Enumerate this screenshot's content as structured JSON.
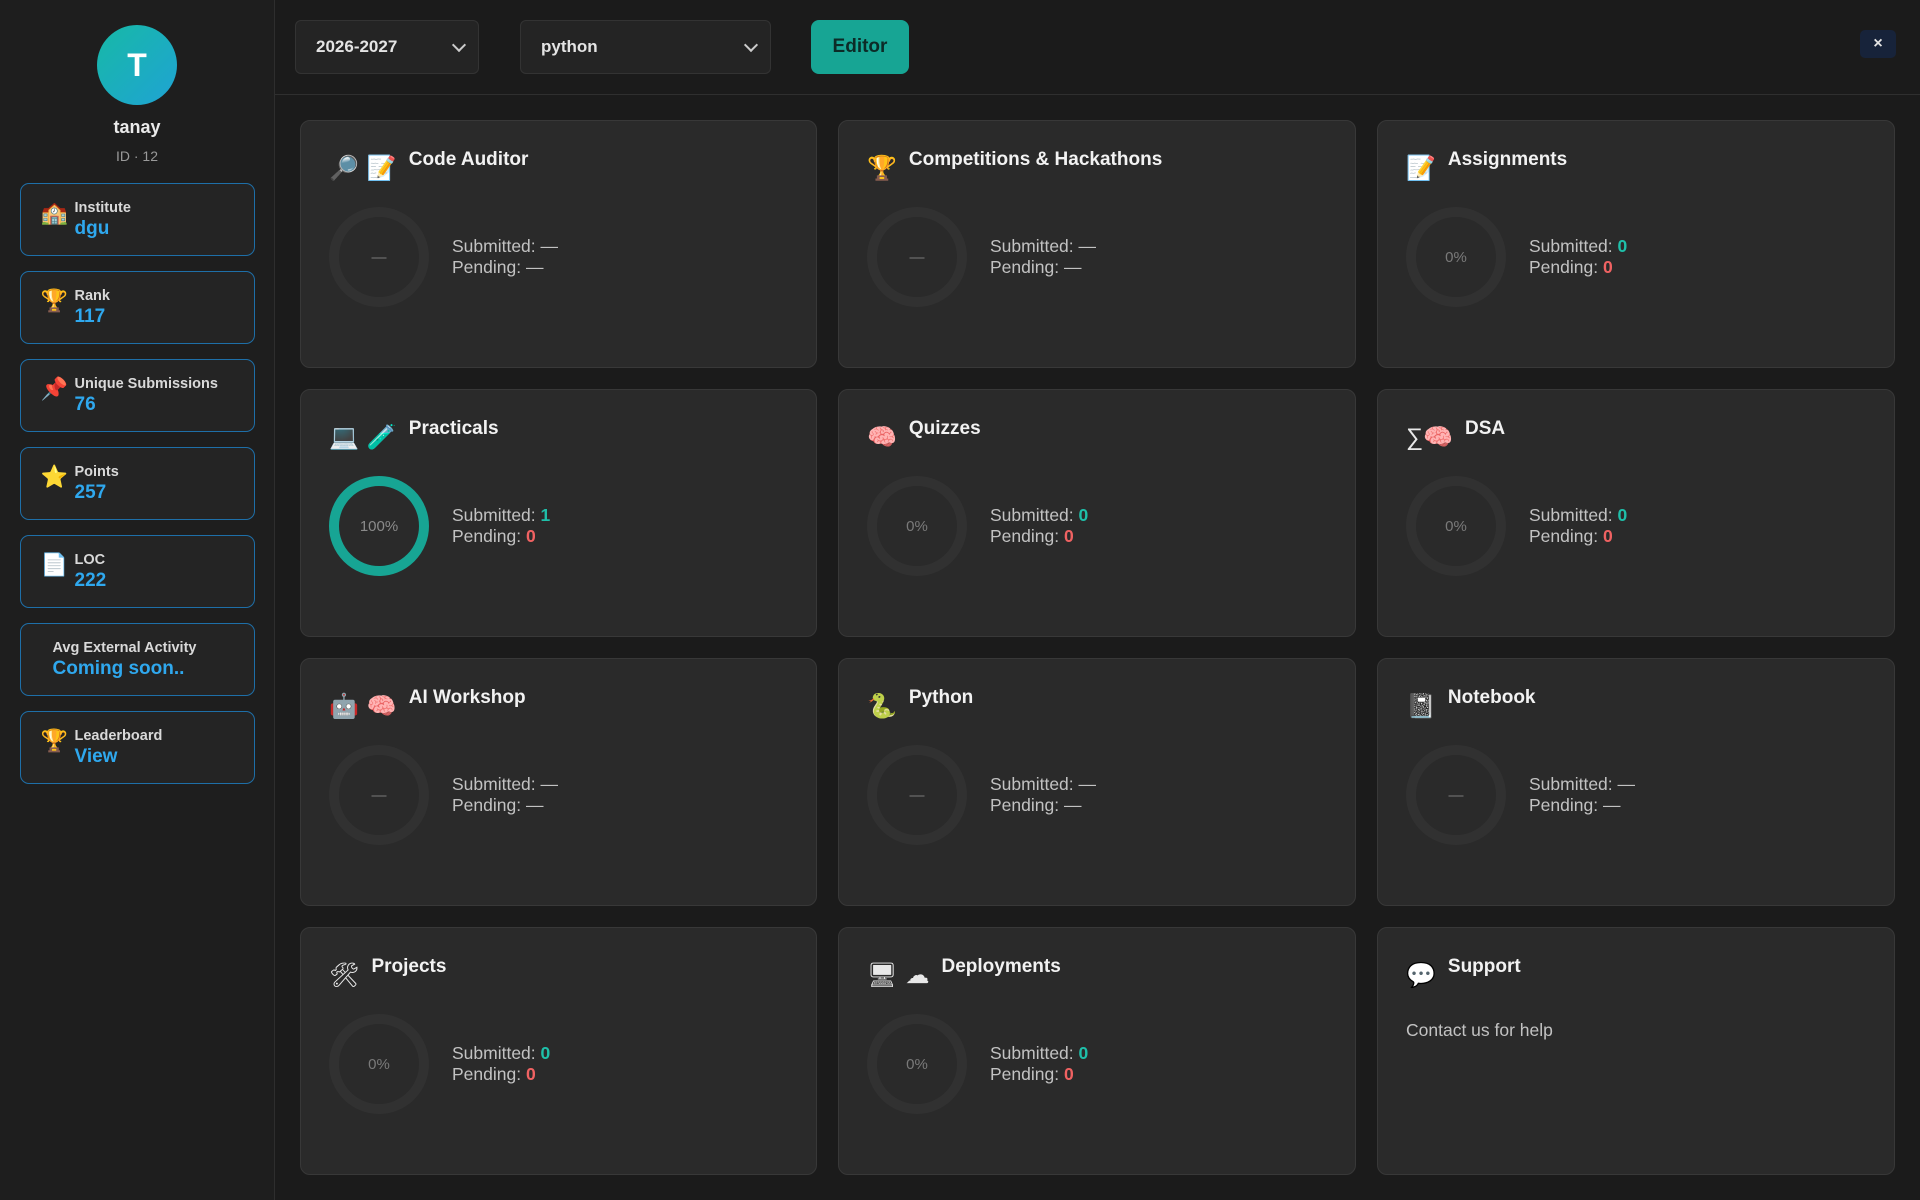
{
  "user": {
    "initial": "T",
    "name": "tanay",
    "id_text": "ID · 12"
  },
  "sidebar": {
    "items": [
      {
        "icon": "🏫",
        "icon_name": "school-icon",
        "label": "Institute",
        "value": "dgu"
      },
      {
        "icon": "🏆",
        "icon_name": "trophy-icon",
        "label": "Rank",
        "value": "117"
      },
      {
        "icon": "📌",
        "icon_name": "pushpin-icon",
        "label": "Unique Submissions",
        "value": "76"
      },
      {
        "icon": "⭐",
        "icon_name": "star-icon",
        "label": "Points",
        "value": "257"
      },
      {
        "icon": "📄",
        "icon_name": "document-icon",
        "label": "LOC",
        "value": "222"
      },
      {
        "icon": "",
        "icon_name": "",
        "label": "Avg External Activity",
        "value": "Coming soon.."
      },
      {
        "icon": "🏆",
        "icon_name": "trophy-icon",
        "label": "Leaderboard",
        "value": "View"
      }
    ]
  },
  "topbar": {
    "year_select": "2026-2027",
    "language_select": "python",
    "editor_label": "Editor",
    "close_label": "×"
  },
  "labels": {
    "submitted": "Submitted: ",
    "pending": "Pending: "
  },
  "cards": [
    {
      "title": "Code Auditor",
      "icons": [
        "🔎",
        "📝"
      ],
      "progress": "—",
      "submitted": "—",
      "pending": "—"
    },
    {
      "title": "Competitions & Hackathons",
      "icons": [
        "🏆"
      ],
      "progress": "—",
      "submitted": "—",
      "pending": "—"
    },
    {
      "title": "Assignments",
      "icons": [
        "📝"
      ],
      "progress": "0%",
      "submitted": "0",
      "pending": "0"
    },
    {
      "title": "Practicals",
      "icons": [
        "💻",
        "🧪"
      ],
      "progress": "100%",
      "submitted": "1",
      "pending": "0"
    },
    {
      "title": "Quizzes",
      "icons": [
        "🧠"
      ],
      "progress": "0%",
      "submitted": "0",
      "pending": "0"
    },
    {
      "title": "DSA",
      "icons": [
        "∑🧠"
      ],
      "progress": "0%",
      "submitted": "0",
      "pending": "0"
    },
    {
      "title": "AI Workshop",
      "icons": [
        "🤖",
        "🧠"
      ],
      "progress": "—",
      "submitted": "—",
      "pending": "—"
    },
    {
      "title": "Python",
      "icons": [
        "🐍"
      ],
      "progress": "—",
      "submitted": "—",
      "pending": "—"
    },
    {
      "title": "Notebook",
      "icons": [
        "📓"
      ],
      "progress": "—",
      "submitted": "—",
      "pending": "—"
    },
    {
      "title": "Projects",
      "icons": [
        "🛠"
      ],
      "progress": "0%",
      "submitted": "0",
      "pending": "0"
    },
    {
      "title": "Deployments",
      "icons": [
        "🖥",
        "☁"
      ],
      "progress": "0%",
      "submitted": "0",
      "pending": "0"
    },
    {
      "title": "Support",
      "icons": [
        "💬"
      ],
      "text": "Contact us for help"
    }
  ],
  "colors": {
    "accent": "#17a594",
    "link_blue": "#2fa8ee",
    "pending_red": "#f06262",
    "card_bg": "#2a2a2a",
    "page_bg": "#1b1b1b"
  }
}
